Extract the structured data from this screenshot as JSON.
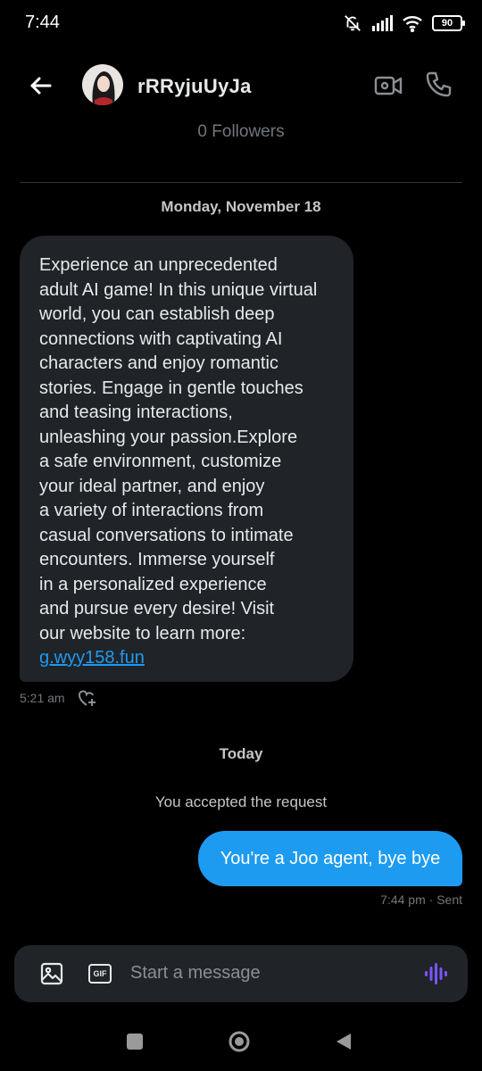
{
  "status": {
    "time": "7:44",
    "battery": "90",
    "icons": [
      "mute-icon",
      "signal-icon",
      "wifi-icon",
      "battery-icon"
    ]
  },
  "header": {
    "name": "rRRyjuUyJa",
    "followers": "0 Followers",
    "icons": [
      "back-arrow-icon",
      "video-camera-icon",
      "phone-icon"
    ]
  },
  "thread": {
    "date_1": "Monday, November 18",
    "incoming": {
      "text": "Experience an unprecedented\nadult AI game! In this unique virtual\nworld, you can establish deep\nconnections with captivating AI\ncharacters and enjoy romantic\nstories. Engage in gentle touches\nand teasing interactions,\nunleashing your passion.Explore\na safe environment, customize\nyour ideal partner, and enjoy\na variety of interactions from\ncasual conversations to intimate\nencounters. Immerse yourself\nin a personalized experience\nand pursue every desire! Visit\nour website to learn more:\n",
      "link": "g.wyy158.fun",
      "time": "5:21 am"
    },
    "date_2": "Today",
    "system": "You accepted the request",
    "outgoing": {
      "text": "You're a Joo agent, bye bye",
      "meta": "7:44 pm · Sent"
    }
  },
  "composer": {
    "placeholder": "Start a message",
    "gif_label": "GIF",
    "icons": [
      "image-icon",
      "gif-icon",
      "voice-icon"
    ]
  },
  "colors": {
    "accent": "#1d9bf0",
    "bubble_incoming": "#202327",
    "voice_icon": "#7856ff"
  }
}
